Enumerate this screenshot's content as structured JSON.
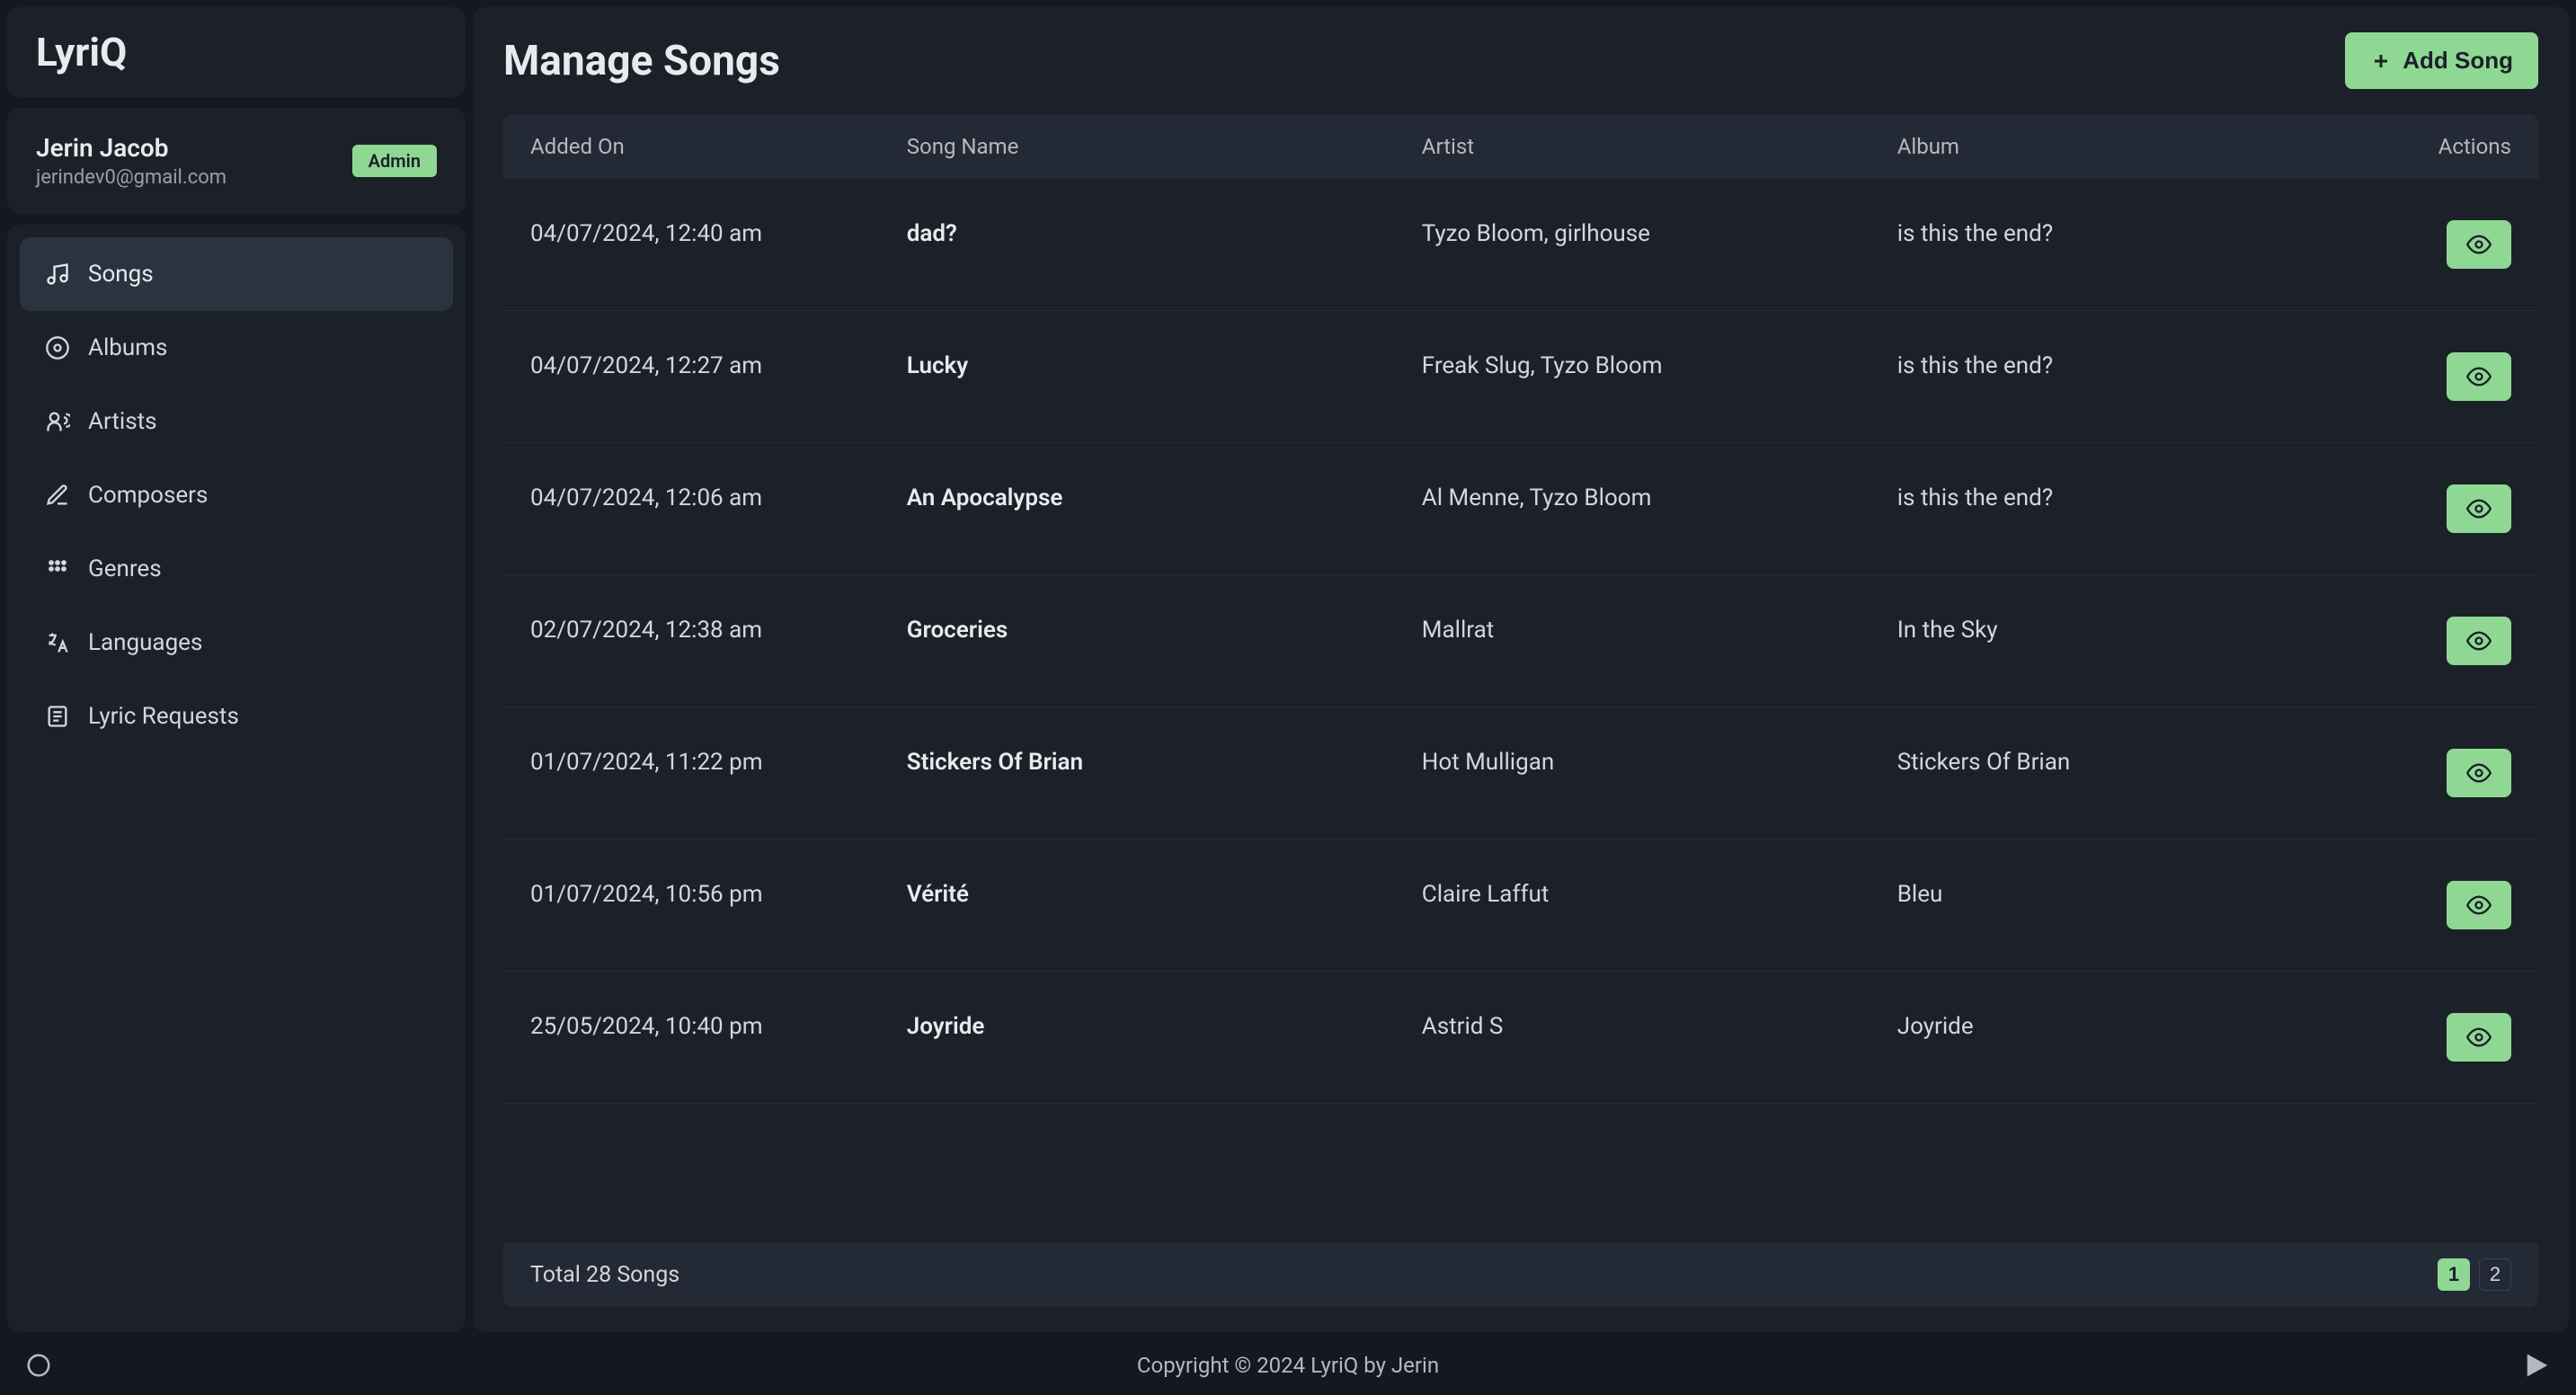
{
  "brand": {
    "name": "LyriQ"
  },
  "account": {
    "name": "Jerin Jacob",
    "email": "jerindev0@gmail.com",
    "role_badge": "Admin"
  },
  "sidebar": {
    "items": [
      {
        "label": "Songs",
        "icon": "music-icon",
        "active": true
      },
      {
        "label": "Albums",
        "icon": "disc-icon",
        "active": false
      },
      {
        "label": "Artists",
        "icon": "user-voice-icon",
        "active": false
      },
      {
        "label": "Composers",
        "icon": "edit-icon",
        "active": false
      },
      {
        "label": "Genres",
        "icon": "grid-icon",
        "active": false
      },
      {
        "label": "Languages",
        "icon": "language-icon",
        "active": false
      },
      {
        "label": "Lyric Requests",
        "icon": "note-icon",
        "active": false
      }
    ]
  },
  "page": {
    "title": "Manage Songs",
    "add_button": "Add Song"
  },
  "table": {
    "columns": {
      "added_on": "Added On",
      "song_name": "Song Name",
      "artist": "Artist",
      "album": "Album",
      "actions": "Actions"
    },
    "rows": [
      {
        "added_on": "04/07/2024, 12:40 am",
        "name": "dad?",
        "artist": "Tyzo Bloom, girlhouse",
        "album": "is this the end?"
      },
      {
        "added_on": "04/07/2024, 12:27 am",
        "name": "Lucky",
        "artist": "Freak Slug, Tyzo Bloom",
        "album": "is this the end?"
      },
      {
        "added_on": "04/07/2024, 12:06 am",
        "name": "An Apocalypse",
        "artist": "Al Menne, Tyzo Bloom",
        "album": "is this the end?"
      },
      {
        "added_on": "02/07/2024, 12:38 am",
        "name": "Groceries",
        "artist": "Mallrat",
        "album": "In the Sky"
      },
      {
        "added_on": "01/07/2024, 11:22 pm",
        "name": "Stickers Of Brian",
        "artist": "Hot Mulligan",
        "album": "Stickers Of Brian"
      },
      {
        "added_on": "01/07/2024, 10:56 pm",
        "name": "Vérité",
        "artist": "Claire Laffut",
        "album": "Bleu"
      },
      {
        "added_on": "25/05/2024, 10:40 pm",
        "name": "Joyride",
        "artist": "Astrid S",
        "album": "Joyride"
      }
    ],
    "total_label": "Total 28 Songs",
    "pages": [
      "1",
      "2"
    ],
    "active_page": 0
  },
  "footer": {
    "copyright": "Copyright © 2024 LyriQ by Jerin"
  }
}
